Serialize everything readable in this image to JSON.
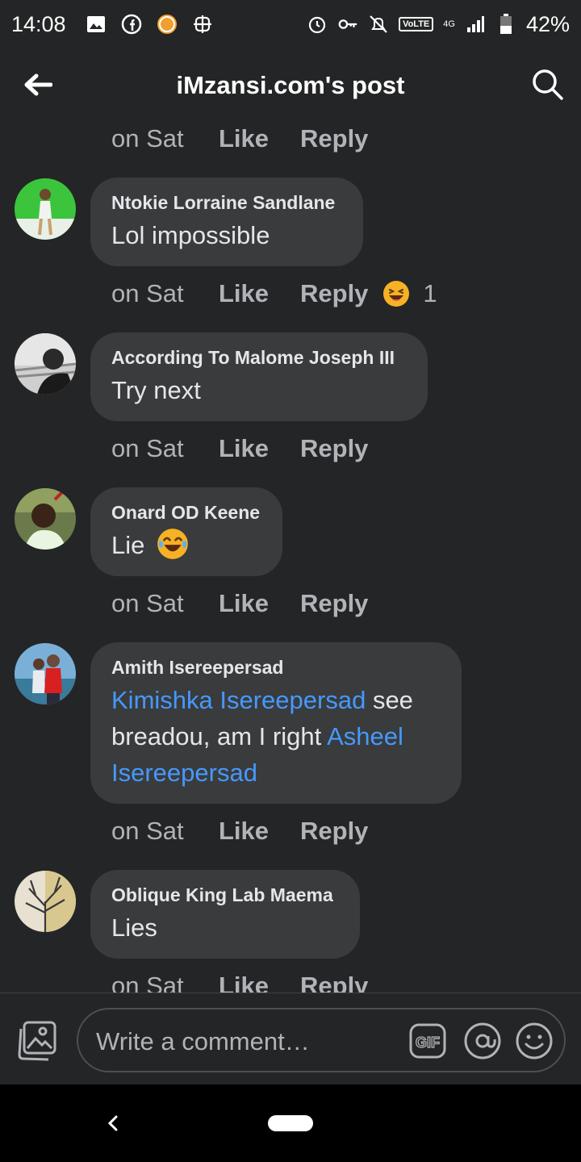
{
  "status_bar": {
    "time": "14:08",
    "network_badge": "VoLTE",
    "network_type": "4G",
    "battery": "42%"
  },
  "header": {
    "title": "iMzansi.com's post"
  },
  "top_actions": {
    "time": "on Sat",
    "like": "Like",
    "reply": "Reply"
  },
  "comments": [
    {
      "author": "Ntokie Lorraine Sandlane",
      "text": "Lol impossible",
      "time": "on Sat",
      "like": "Like",
      "reply": "Reply",
      "reaction_count": "1",
      "reaction_icon": "laughing-emoji-icon"
    },
    {
      "author": "According To Malome Joseph III",
      "text": "Try next",
      "time": "on Sat",
      "like": "Like",
      "reply": "Reply"
    },
    {
      "author": "Onard OD Keene",
      "text": "Lie",
      "time": "on Sat",
      "like": "Like",
      "reply": "Reply"
    },
    {
      "author": "Amith Isereepersad",
      "mention1": "Kimishka Isereepersad",
      "text_middle": " see breadou, am I right ",
      "mention2": "Asheel Isereepersad",
      "time": "on Sat",
      "like": "Like",
      "reply": "Reply"
    },
    {
      "author": "Oblique King Lab Maema",
      "text": "Lies",
      "time": "on Sat",
      "like": "Like",
      "reply": "Reply"
    }
  ],
  "composer": {
    "placeholder": "Write a comment…",
    "gif_label": "GIF"
  },
  "colors": {
    "background": "#242526",
    "bubble": "#3a3b3c",
    "mention": "#4599ff",
    "secondary_text": "#b0b3b8"
  }
}
